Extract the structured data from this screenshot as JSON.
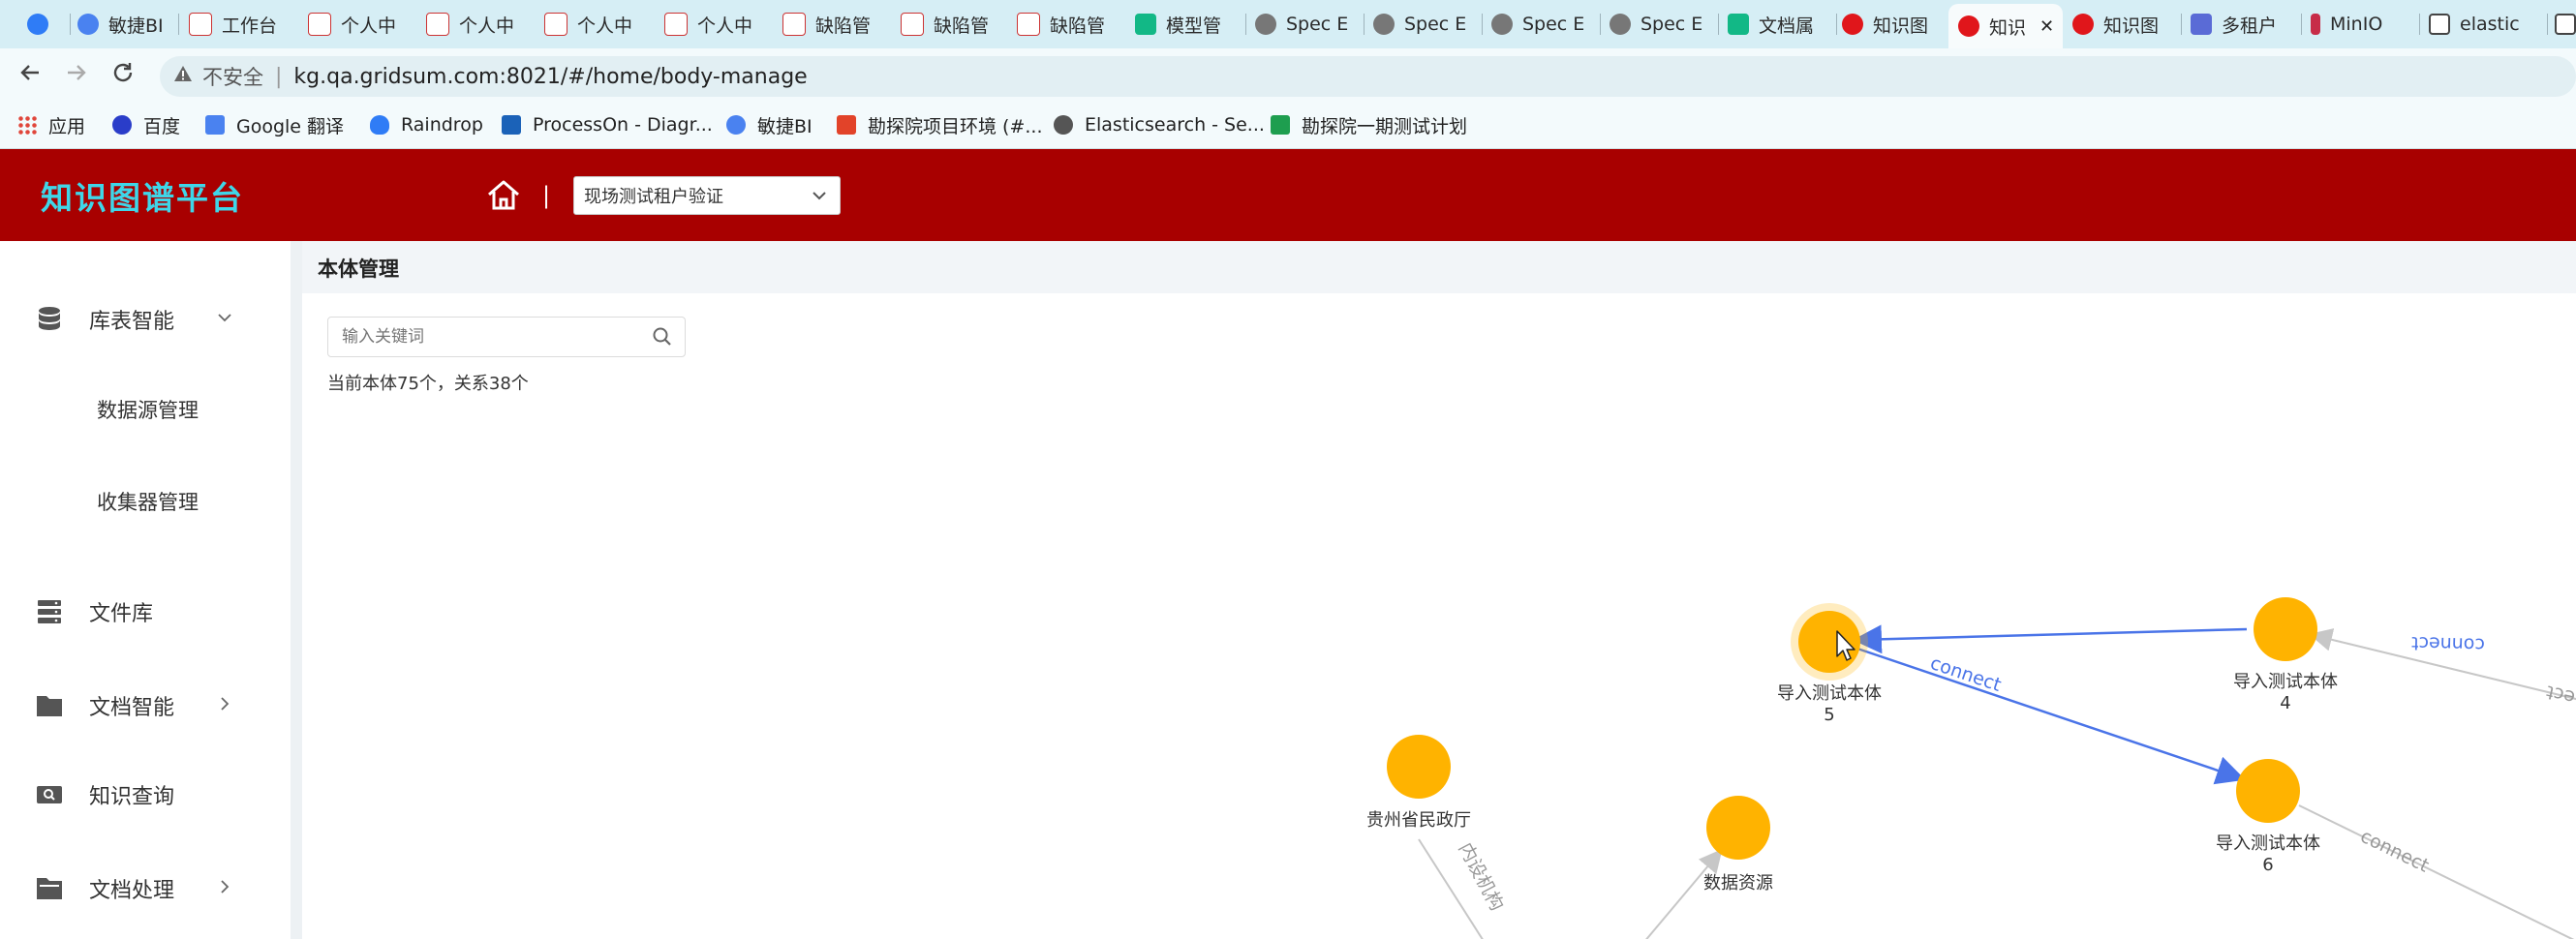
{
  "browser": {
    "tabs": [
      {
        "label": ""
      },
      {
        "label": "敏捷BI"
      },
      {
        "label": "工作台"
      },
      {
        "label": "个人中"
      },
      {
        "label": "个人中"
      },
      {
        "label": "个人中"
      },
      {
        "label": "个人中"
      },
      {
        "label": "缺陷管"
      },
      {
        "label": "缺陷管"
      },
      {
        "label": "缺陷管"
      },
      {
        "label": "模型管"
      },
      {
        "label": "Spec E"
      },
      {
        "label": "Spec E"
      },
      {
        "label": "Spec E"
      },
      {
        "label": "Spec E"
      },
      {
        "label": "文档属"
      },
      {
        "label": "知识图"
      },
      {
        "label": "知识"
      },
      {
        "label": "知识图"
      },
      {
        "label": "多租户"
      },
      {
        "label": "MinIO"
      },
      {
        "label": "elastic"
      }
    ],
    "active_tab_close": "✕",
    "security_label": "不安全",
    "url": "kg.qa.gridsum.com:8021/#/home/body-manage",
    "bookmarks": [
      {
        "label": "应用",
        "color": "#e0463b"
      },
      {
        "label": "百度",
        "color": "#2a3dc9"
      },
      {
        "label": "Google 翻译",
        "color": "#4a82f0"
      },
      {
        "label": "Raindrop",
        "color": "#2f7cf6"
      },
      {
        "label": "ProcessOn - Diagr...",
        "color": "#1b62b8"
      },
      {
        "label": "敏捷BI",
        "color": "#4a82f0"
      },
      {
        "label": "勘探院项目环境 (#...",
        "color": "#e24329"
      },
      {
        "label": "Elasticsearch - Se...",
        "color": "#555555"
      },
      {
        "label": "勘探院一期测试计划",
        "color": "#1e9e4f"
      }
    ]
  },
  "header": {
    "brand": "知识图谱平台",
    "separator": "|",
    "tenant_value": "现场测试租户验证",
    "colors": {
      "bar": "#a80000",
      "brand": "#3fd6e8"
    }
  },
  "sidebar": {
    "items": [
      {
        "label": "库表智能",
        "icon": "database-icon",
        "chevron": "expanded"
      },
      {
        "label": "数据源管理"
      },
      {
        "label": "收集器管理"
      },
      {
        "label": "文件库",
        "icon": "server-icon"
      },
      {
        "label": "文档智能",
        "icon": "folder-icon",
        "chevron": "collapsed"
      },
      {
        "label": "知识查询",
        "icon": "search-box-icon"
      },
      {
        "label": "文档处理",
        "icon": "folder-open-icon",
        "chevron": "collapsed"
      }
    ]
  },
  "main": {
    "title": "本体管理",
    "search_placeholder": "输入关键词",
    "stats": "当前本体75个，关系38个"
  },
  "graph": {
    "node_color": "#ffb300",
    "edge_highlight_color": "#4a74e8",
    "nodes": [
      {
        "id": "n5",
        "label": "导入测试本体",
        "sub": "5"
      },
      {
        "id": "n4",
        "label": "导入测试本体",
        "sub": "4"
      },
      {
        "id": "n6",
        "label": "导入测试本体",
        "sub": "6"
      },
      {
        "id": "gz",
        "label": "贵州省民政厅",
        "sub": ""
      },
      {
        "id": "ds",
        "label": "数据资源",
        "sub": ""
      }
    ],
    "edges": [
      {
        "label": "connect"
      },
      {
        "label": "connect"
      },
      {
        "label": "connect"
      },
      {
        "label": "内设机构"
      },
      {
        "label": "ect"
      }
    ]
  }
}
